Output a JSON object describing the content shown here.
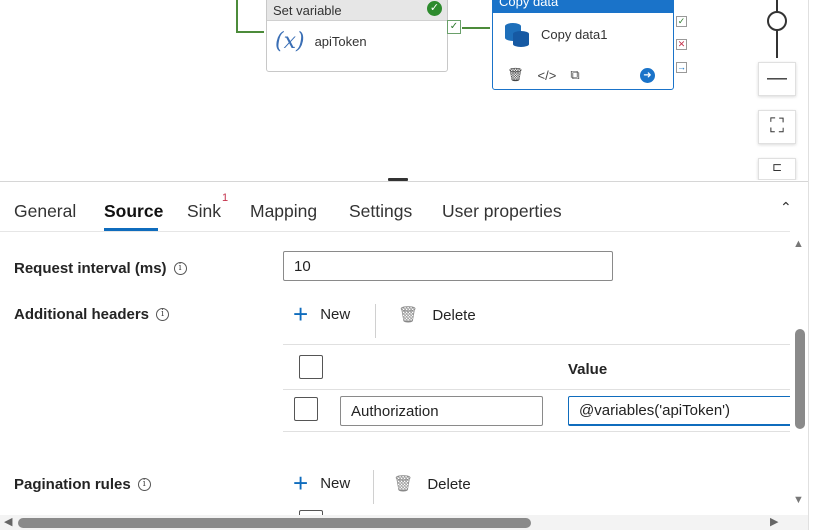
{
  "canvas": {
    "set_variable_node": {
      "title": "Set variable",
      "label": "apiToken",
      "icon": "fx-icon"
    },
    "copy_data_node": {
      "title": "Copy data",
      "label": "Copy data1",
      "icon": "database-icon"
    }
  },
  "tabs": [
    {
      "label": "General"
    },
    {
      "label": "Source"
    },
    {
      "label": "Sink"
    },
    {
      "label": "Mapping"
    },
    {
      "label": "Settings"
    },
    {
      "label": "User properties"
    }
  ],
  "active_tab": "Source",
  "sink_badge": "1",
  "source": {
    "request_interval": {
      "label": "Request interval (ms)",
      "value": "10"
    },
    "additional_headers": {
      "label": "Additional headers",
      "new_label": "New",
      "delete_label": "Delete",
      "value_header": "Value",
      "rows": [
        {
          "name": "Authorization",
          "value": "@variables('apiToken')"
        }
      ]
    },
    "pagination_rules": {
      "label": "Pagination rules",
      "new_label": "New",
      "delete_label": "Delete"
    }
  },
  "colors": {
    "accent": "#0f6cbd",
    "success": "#2e8b2e",
    "copy_header": "#1a73c9"
  }
}
